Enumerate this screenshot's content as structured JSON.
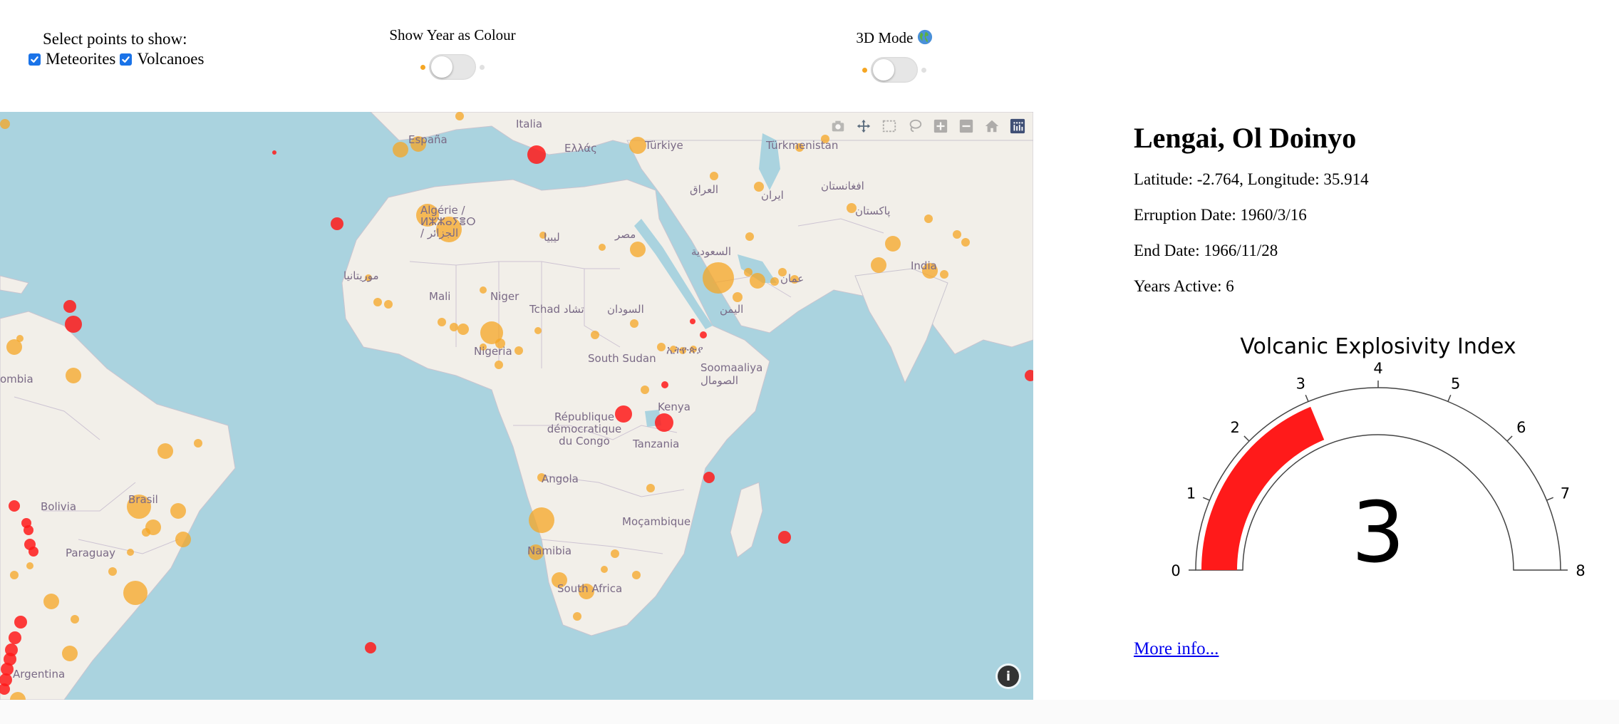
{
  "controls": {
    "select_title": "Select points to show:",
    "meteorites_label": "Meteorites",
    "volcanoes_label": "Volcanoes",
    "meteorites_checked": true,
    "volcanoes_checked": true,
    "year_colour_label": "Show Year as Colour",
    "year_colour_on": false,
    "mode3d_label": "3D Mode",
    "mode3d_icon": "globe-icon",
    "mode3d_on": false
  },
  "map": {
    "modebar_icons": [
      "camera-icon",
      "pan-icon",
      "box-select-icon",
      "lasso-icon",
      "zoom-in-icon",
      "zoom-out-icon",
      "reset-view-icon",
      "plotly-logo-icon"
    ],
    "labels": [
      "España",
      "Italia",
      "Ελλάς",
      "Türkiye",
      "Türkmenistan",
      "Algérie / ⵍⵣⵣⴰⵢⴻⵔ / الجزائر",
      "ليبيا",
      "مصر",
      "العراق",
      "ایران",
      "افغانستان",
      "پاکستان",
      "السعودية",
      "عمان",
      "India",
      "موريتانيا",
      "Mali",
      "Niger",
      "Tchad تشاد",
      "السودان",
      "اليمن",
      "Nigeria",
      "South Sudan",
      "ኢትዮጵያ",
      "Soomaaliya الصومال",
      "République démocratique du Congo",
      "Kenya",
      "Tanzania",
      "Angola",
      "Moçambique",
      "Namibia",
      "South Africa",
      "Brasil",
      "Bolivia",
      "Paraguay",
      "Argentina",
      "ombia"
    ],
    "info_label": "i",
    "meteorite_color": "#f5a623",
    "volcano_color": "#ff1a1a",
    "water_color": "#aad3df",
    "land_color": "#f2efe9"
  },
  "detail": {
    "name": "Lengai, Ol Doinyo",
    "coords": "Latitude: -2.764, Longitude: 35.914",
    "eruption": "Erruption Date: 1960/3/16",
    "end": "End Date: 1966/11/28",
    "years": "Years Active: 6",
    "more_info": "More info..."
  },
  "gauge": {
    "title": "Volcanic Explosivity Index",
    "value": 3,
    "min": 0,
    "max": 8,
    "ticks": [
      "0",
      "1",
      "2",
      "3",
      "4",
      "5",
      "6",
      "7",
      "8"
    ],
    "bar_color": "#ff1a1a"
  }
}
